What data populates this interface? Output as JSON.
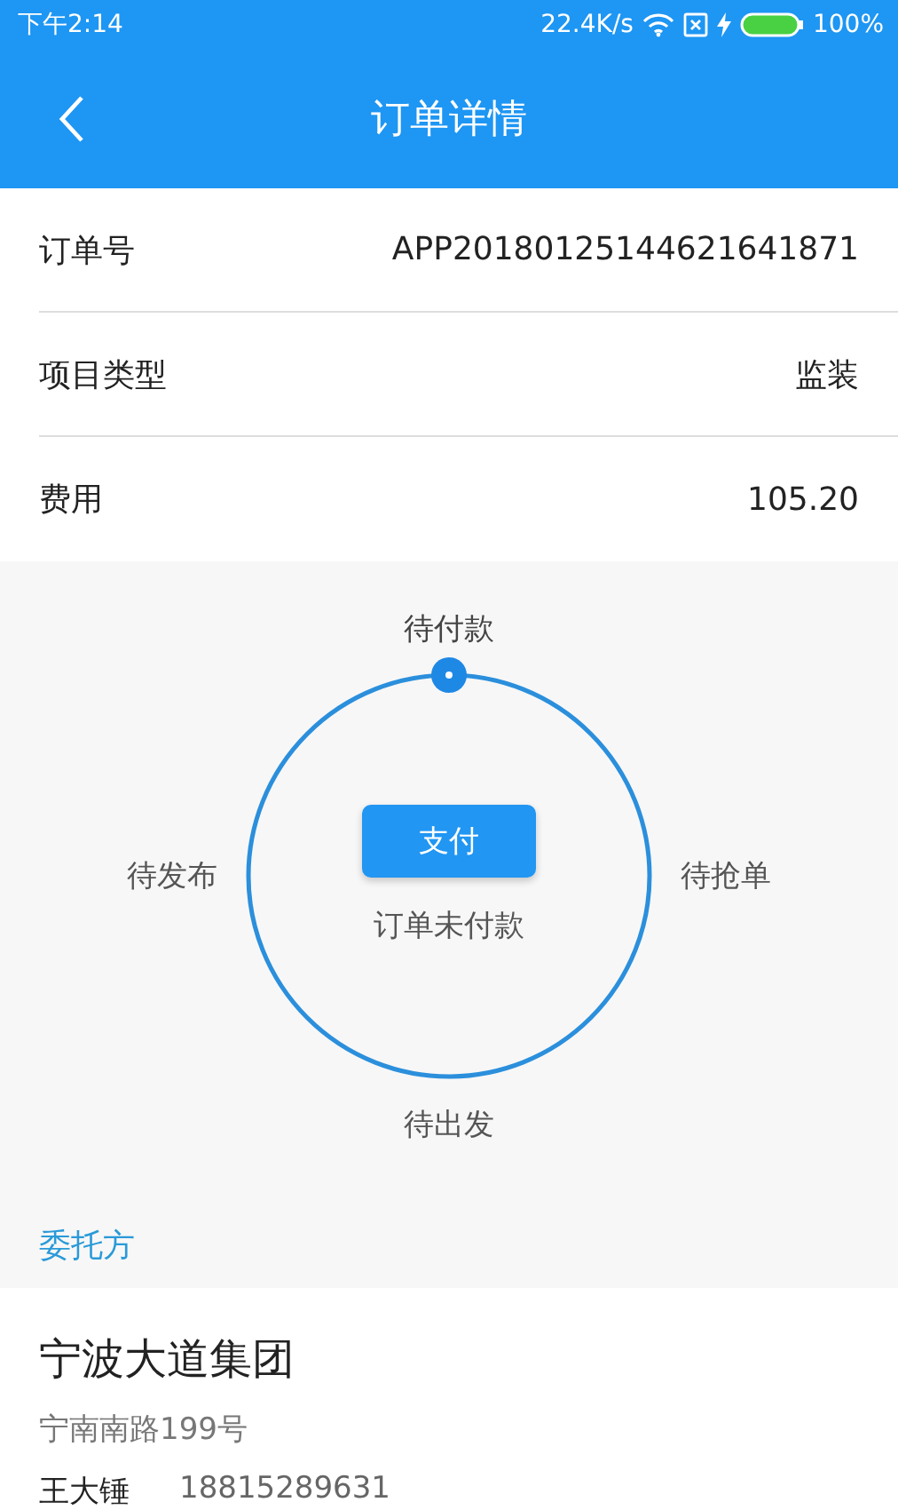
{
  "status_bar": {
    "time": "下午2:14",
    "speed": "22.4K/s",
    "battery": "100%"
  },
  "header": {
    "title": "订单详情"
  },
  "details": [
    {
      "label": "订单号",
      "value": "APP20180125144621641871"
    },
    {
      "label": "项目类型",
      "value": "监装"
    },
    {
      "label": "费用",
      "value": "105.20"
    }
  ],
  "progress": {
    "stages": [
      {
        "label": "待付款",
        "kind": "top",
        "selected": true
      },
      {
        "label": "待抢单",
        "kind": "right",
        "selected": false
      },
      {
        "label": "待出发",
        "kind": "bottom",
        "selected": false
      },
      {
        "label": "待发布",
        "kind": "left",
        "selected": false
      }
    ],
    "button": "支付",
    "status": "订单未付款"
  },
  "client": {
    "section_title": "委托方",
    "name": "宁波大道集团",
    "address": "宁南南路199号",
    "contact_name": "王大锤",
    "phone": "18815289631"
  }
}
